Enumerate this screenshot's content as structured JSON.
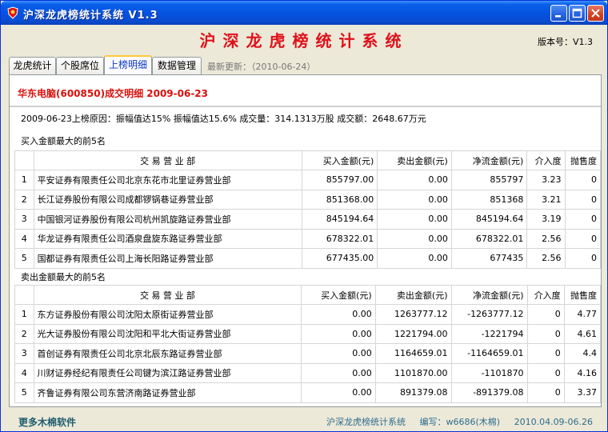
{
  "window": {
    "title": "沪深龙虎榜统计系统 V1.3",
    "heading": "沪深龙虎榜统计系统",
    "version": "版本号：V1.3"
  },
  "tabs": [
    {
      "label": "龙虎统计"
    },
    {
      "label": "个股席位"
    },
    {
      "label": "上榜明细",
      "active": true
    },
    {
      "label": "数据管理"
    }
  ],
  "last_update": "最新更新：（2010-06-24）",
  "detail": {
    "title": "华东电脑(600850)成交明细  2009-06-23",
    "summary": "2009-06-23上榜原因：振幅值达15%    振幅值达15.6%   成交量：314.1313万股   成交额：2648.67万元"
  },
  "columns": [
    "交 易 营 业 部",
    "买入金额(元)",
    "卖出金额(元)",
    "净流金额(元)",
    "介入度",
    "抛售度"
  ],
  "buy_section": {
    "label": "买入金额最大的前5名",
    "rows": [
      {
        "idx": "1",
        "dept": "平安证券有限责任公司北京东花市北里证券营业部",
        "buy": "855797.00",
        "sell": "0.00",
        "net": "855797",
        "in": "3.23",
        "out": "0"
      },
      {
        "idx": "2",
        "dept": "长江证券股份有限公司成都锣锅巷证券营业部",
        "buy": "851368.00",
        "sell": "0.00",
        "net": "851368",
        "in": "3.21",
        "out": "0"
      },
      {
        "idx": "3",
        "dept": "中国银河证券股份有限公司杭州凯旋路证券营业部",
        "buy": "845194.64",
        "sell": "0.00",
        "net": "845194.64",
        "in": "3.19",
        "out": "0"
      },
      {
        "idx": "4",
        "dept": "华龙证券有限责任公司酒泉盘旋东路证券营业部",
        "buy": "678322.01",
        "sell": "0.00",
        "net": "678322.01",
        "in": "2.56",
        "out": "0"
      },
      {
        "idx": "5",
        "dept": "国都证券有限责任公司上海长阳路证券营业部",
        "buy": "677435.00",
        "sell": "0.00",
        "net": "677435",
        "in": "2.56",
        "out": "0"
      }
    ]
  },
  "sell_section": {
    "label": "卖出金额最大的前5名",
    "rows": [
      {
        "idx": "1",
        "dept": "东方证券股份有限公司沈阳太原街证券营业部",
        "buy": "0.00",
        "sell": "1263777.12",
        "net": "-1263777.12",
        "in": "0",
        "out": "4.77"
      },
      {
        "idx": "2",
        "dept": "光大证券股份有限公司沈阳和平北大街证券营业部",
        "buy": "0.00",
        "sell": "1221794.00",
        "net": "-1221794",
        "in": "0",
        "out": "4.61"
      },
      {
        "idx": "3",
        "dept": "首创证券有限责任公司北京北辰东路证券营业部",
        "buy": "0.00",
        "sell": "1164659.01",
        "net": "-1164659.01",
        "in": "0",
        "out": "4.4"
      },
      {
        "idx": "4",
        "dept": "川财证券经纪有限责任公司键为滨江路证券营业部",
        "buy": "0.00",
        "sell": "1101870.00",
        "net": "-1101870",
        "in": "0",
        "out": "4.16"
      },
      {
        "idx": "5",
        "dept": "齐鲁证券有限公司东营济南路证券营业部",
        "buy": "0.00",
        "sell": "891379.08",
        "net": "-891379.08",
        "in": "0",
        "out": "3.37"
      }
    ]
  },
  "footer": {
    "more_link": "更多木棉软件",
    "app_name": "沪深龙虎榜统计系统",
    "author": "编写：w6686(木棉)",
    "dates": "2010.04.09-06.26"
  },
  "colors": {
    "heading": "#E0101A",
    "accent_title": "#D8100C",
    "titlebar": "#0553E0"
  }
}
